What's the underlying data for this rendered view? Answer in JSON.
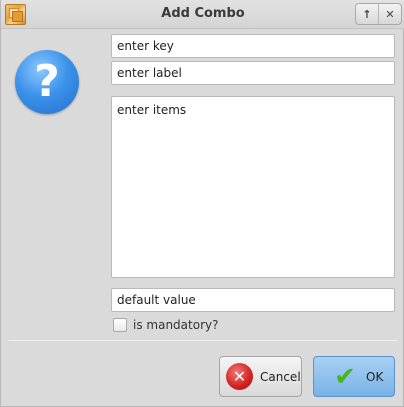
{
  "window": {
    "title": "Add Combo",
    "buttons": {
      "up_icon": "arrow-up-icon",
      "close_icon": "close-icon",
      "up_glyph": "↑",
      "close_glyph": "✕"
    }
  },
  "dialog": {
    "icon": "question-icon",
    "icon_glyph": "?",
    "key_field": {
      "value": "enter key"
    },
    "label_field": {
      "value": "enter label"
    },
    "items_field": {
      "value": "enter items"
    },
    "default_field": {
      "value": "default value"
    },
    "mandatory": {
      "label": "is mandatory?",
      "checked": false
    }
  },
  "buttons": {
    "cancel": {
      "label": "Cancel",
      "icon": "cancel-icon",
      "glyph": "✕"
    },
    "ok": {
      "label": "OK",
      "icon": "checkmark-icon",
      "glyph": "✔"
    }
  },
  "colors": {
    "accent": "#79b2e6",
    "cancel_red": "#d21f1f",
    "ok_green": "#49b51d",
    "question_blue": "#3d93ea"
  }
}
